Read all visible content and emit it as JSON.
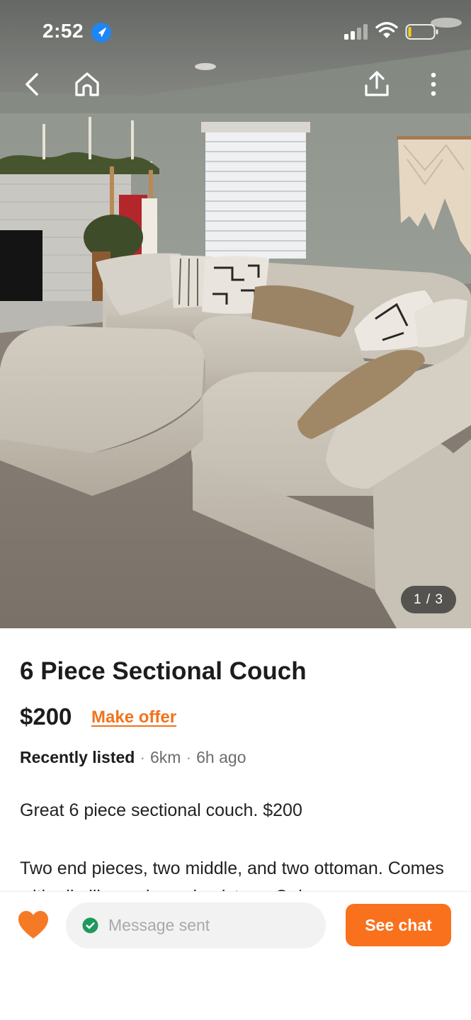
{
  "status_bar": {
    "time": "2:52",
    "icons": [
      "location-arrow-icon",
      "cell-signal-icon",
      "wifi-icon",
      "battery-icon"
    ]
  },
  "nav": {
    "icons": [
      "back-chevron-icon",
      "home-icon",
      "share-icon",
      "more-vertical-icon"
    ]
  },
  "gallery": {
    "counter": "1 / 3",
    "current_image": 1,
    "total_images": 3
  },
  "listing": {
    "title": "6 Piece Sectional Couch",
    "price": "$200",
    "make_offer_label": "Make offer",
    "status": "Recently listed",
    "distance": "6km",
    "posted": "6h ago",
    "description": [
      "Great 6 piece sectional couch. $200",
      "Two end pieces, two middle, and two ottoman. Comes with all pillows shown in picture. Only a"
    ]
  },
  "bottom_bar": {
    "favorite_icon": "heart-icon",
    "message_status": "Message sent",
    "message_status_icon": "check-circle-icon",
    "see_chat_label": "See chat"
  },
  "colors": {
    "accent": "#f9711c",
    "offer_link": "#f0731e",
    "check_green": "#1f9a5c",
    "pill_bg": "#f2f2f2"
  }
}
